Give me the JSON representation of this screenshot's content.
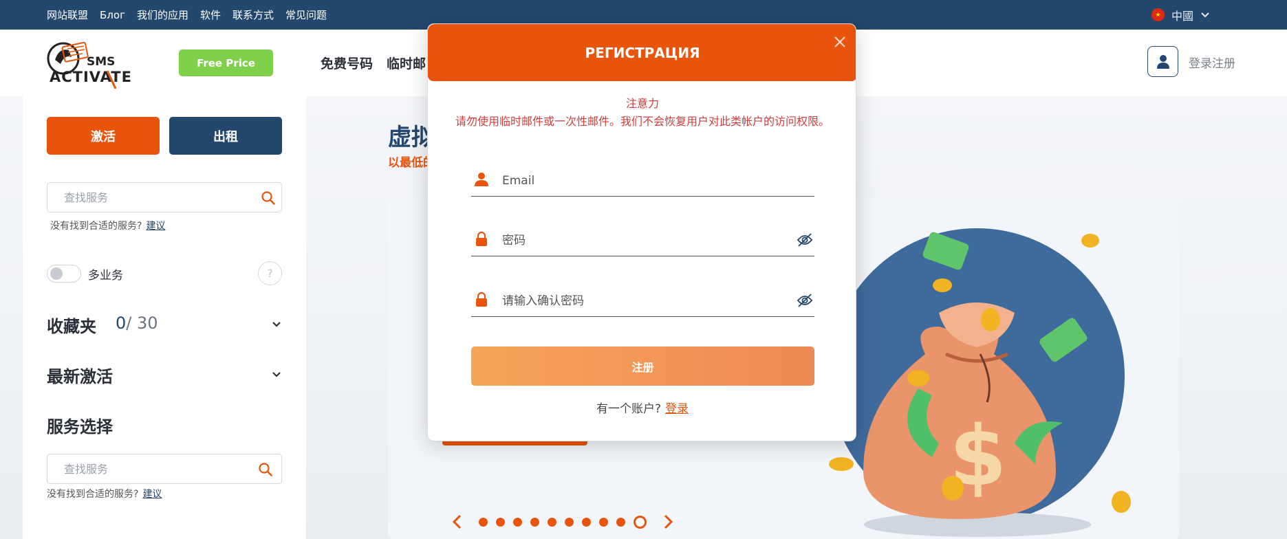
{
  "topbar": {
    "nav": [
      "网站联盟",
      "Блог",
      "我们的应用",
      "软件",
      "联系方式",
      "常见问题"
    ],
    "language": "中國"
  },
  "header": {
    "logo_text": [
      "SMS",
      "ACTIVATE"
    ],
    "free_price_label": "Free Price",
    "nav": [
      "免费号码",
      "临时邮"
    ],
    "login_label": "登录注册"
  },
  "sidebar": {
    "activate_label": "激活",
    "rent_label": "出租",
    "search_placeholder": "查找服务",
    "not_found_text": "没有找到合适的服务?",
    "suggest_link": "建议",
    "multi_service_label": "多业务",
    "help_mark": "?",
    "favorites_title": "收藏夹",
    "favorites_count": "0",
    "favorites_total": "/ 30",
    "recent_title": "最新激活",
    "service_select_title": "服务选择",
    "search2_placeholder": "查找服务",
    "not_found_text2": "没有找到合适的服务?",
    "suggest_link2": "建议"
  },
  "hero": {
    "title_partial": "虚拟",
    "subtitle_partial": "以最低的",
    "carousel_dots": 10,
    "carousel_active_index": 9,
    "money_symbol": "$"
  },
  "modal": {
    "title": "РЕГИСТРАЦИЯ",
    "notice_title": "注意力",
    "notice_body": "请勿使用临时邮件或一次性邮件。我们不会恢复用户对此类帐户的访问权限。",
    "email_placeholder": "Email",
    "password_placeholder": "密码",
    "confirm_placeholder": "请输入确认密码",
    "submit_label": "注册",
    "have_account_text": "有一个账户?",
    "login_link": "登录"
  },
  "colors": {
    "brand_orange": "#e8540c",
    "brand_navy": "#24476e",
    "free_green": "#7fd04a"
  }
}
